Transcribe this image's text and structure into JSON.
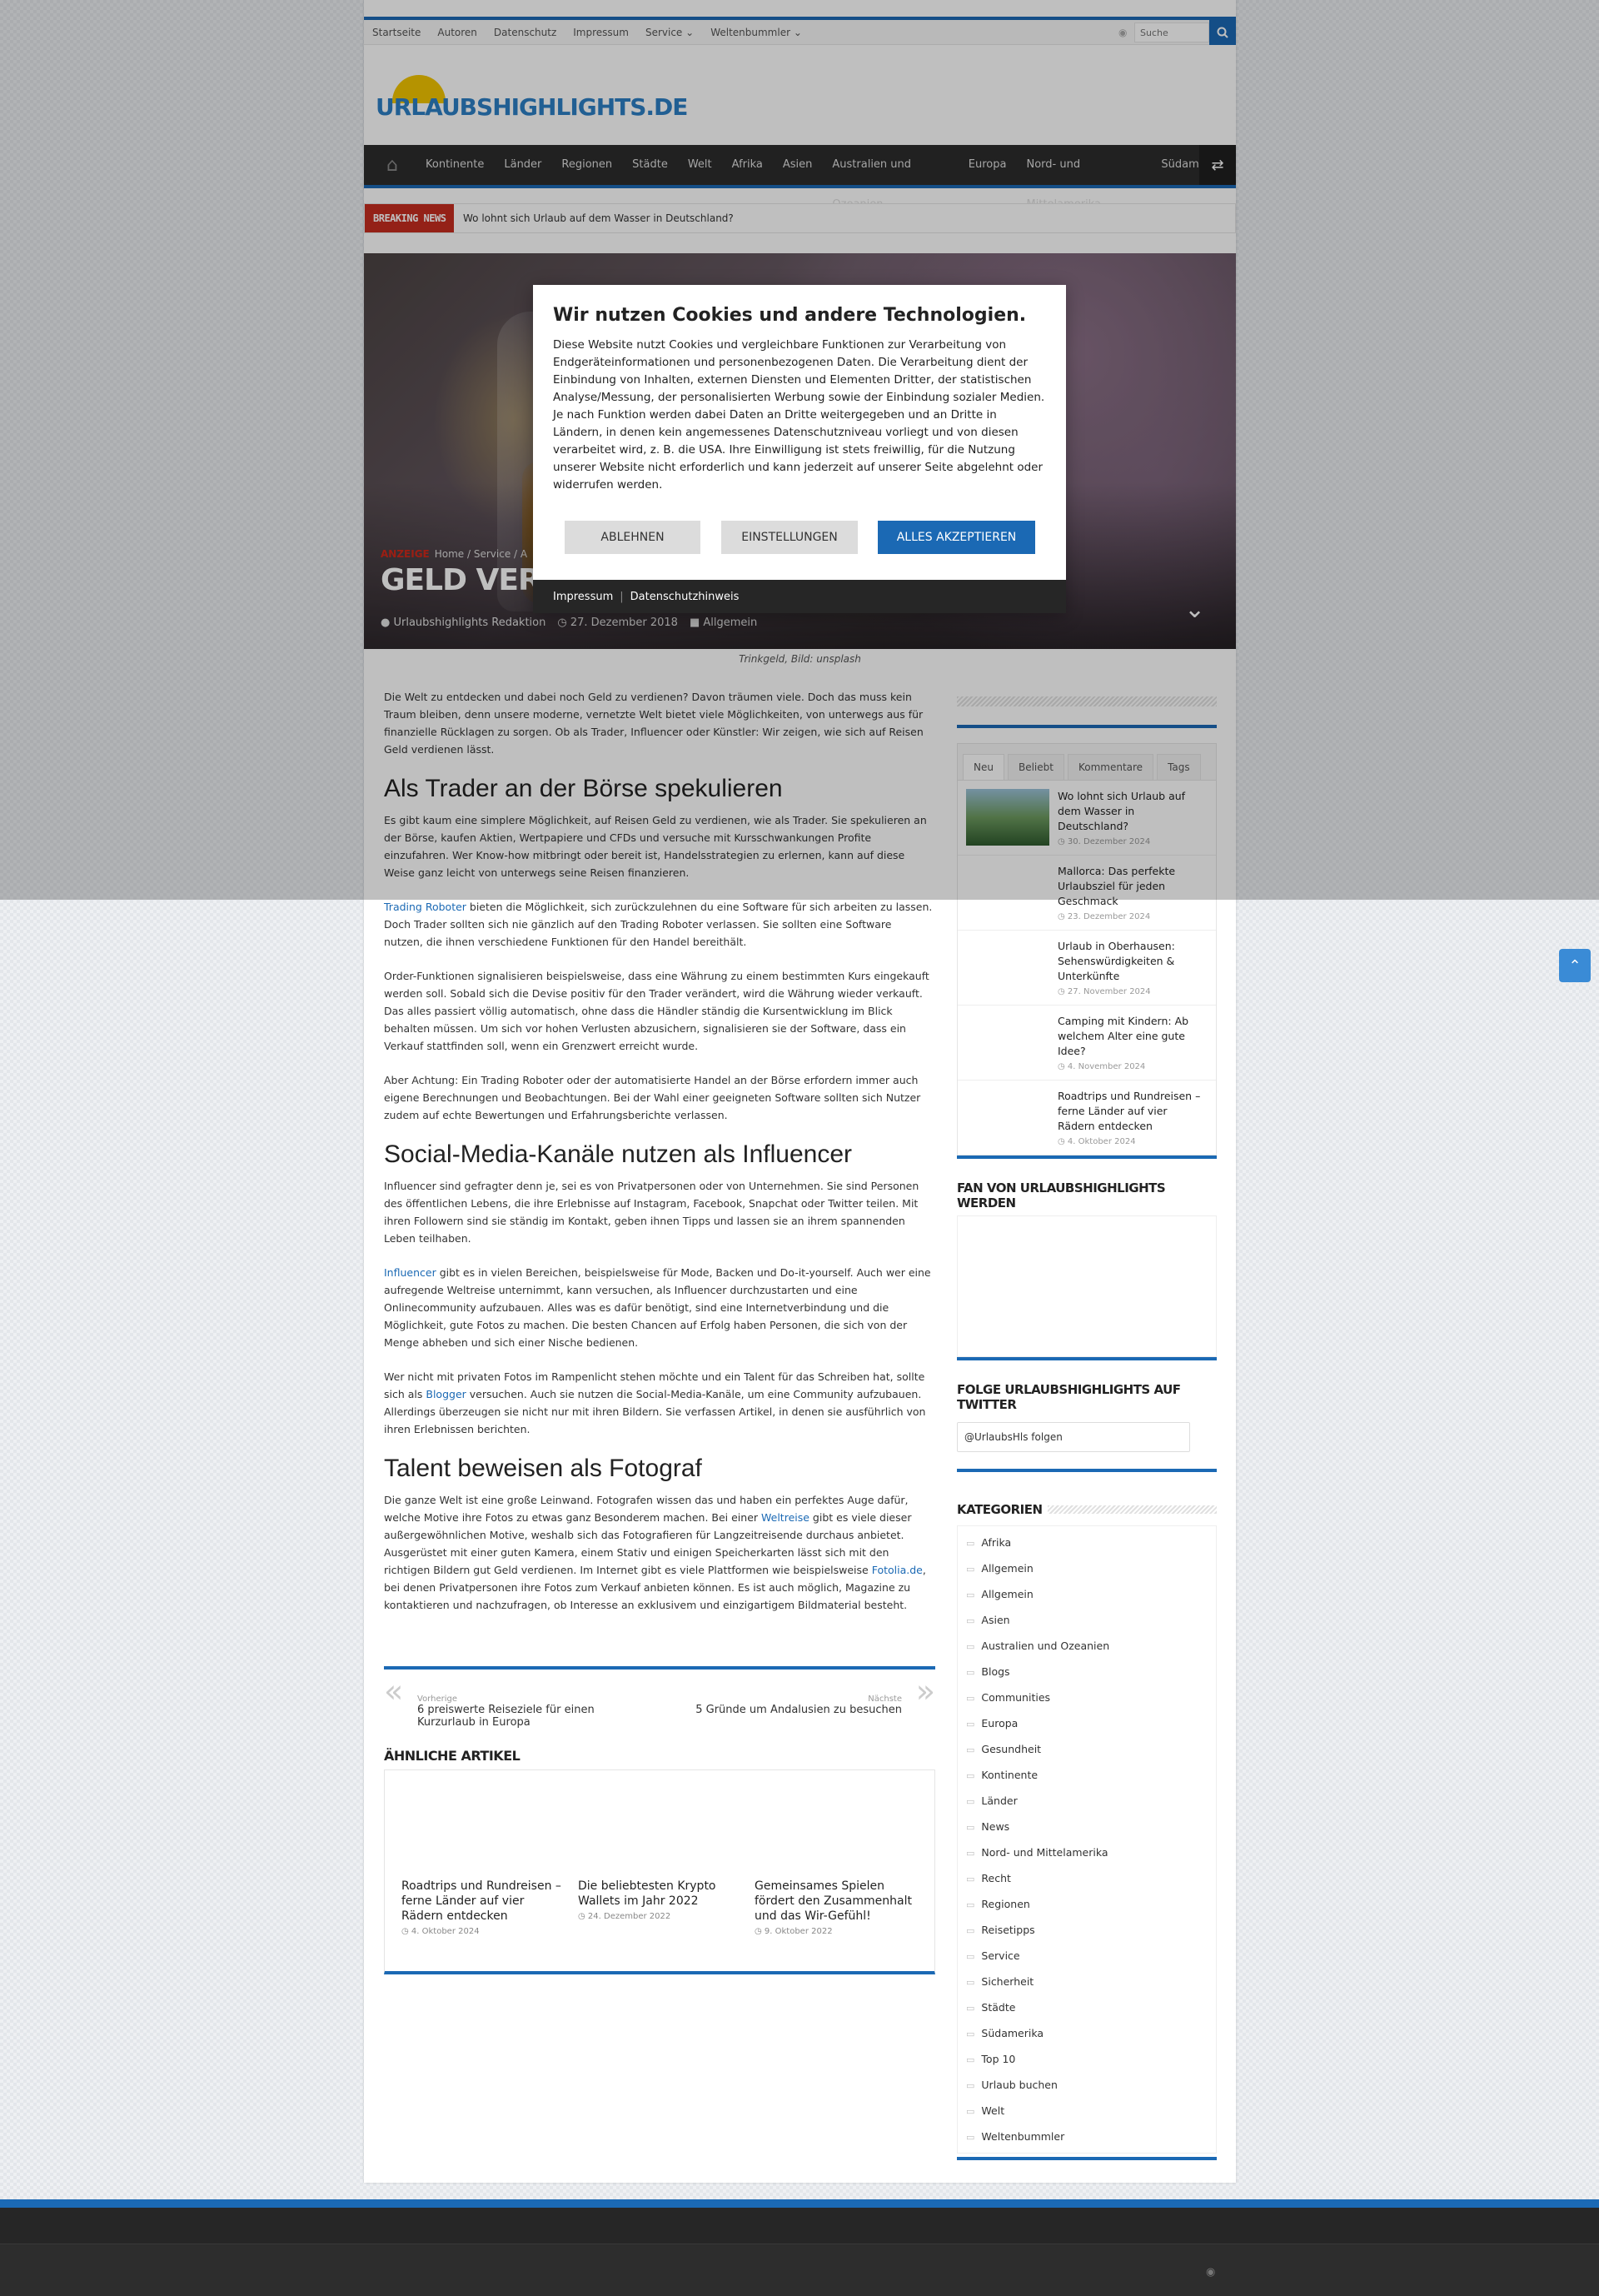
{
  "topnav": [
    "Startseite",
    "Autoren",
    "Datenschutz",
    "Impressum",
    "Service ⌄",
    "Weltenbummler ⌄"
  ],
  "search_placeholder": "Suche",
  "logo": {
    "part1": "URLAUBS",
    "part2": "HIGHLIGHTS.DE"
  },
  "mainnav": [
    "Kontinente",
    "Länder",
    "Regionen",
    "Städte",
    "Welt",
    "Afrika",
    "Asien",
    "Australien und Ozeanien",
    "Europa",
    "Nord- und Mittelamerika",
    "Südamerika"
  ],
  "breaking": {
    "label": "BREAKING NEWS",
    "text": "Wo lohnt sich Urlaub auf dem Wasser in Deutschland?"
  },
  "hero": {
    "ad": "ANZEIGE",
    "crumbs": "Home / Service / A",
    "title": "GELD VERDIE",
    "author": "Urlaubshighlights Redaktion",
    "date": "27. Dezember 2018",
    "category": "Allgemein"
  },
  "caption": "Trinkgeld, Bild: unsplash",
  "article": {
    "intro": "Die Welt zu entdecken und dabei noch Geld zu verdienen? Davon träumen viele. Doch das muss kein Traum bleiben, denn unsere moderne, vernetzte Welt bietet viele Möglichkeiten, von unterwegs aus für finanzielle Rücklagen zu sorgen. Ob als Trader, Influencer oder Künstler: Wir zeigen, wie sich auf Reisen Geld verdienen lässt.",
    "h1": "Als Trader an der Börse spekulieren",
    "p1": "Es gibt kaum eine simplere Möglichkeit, auf Reisen Geld zu verdienen, wie als Trader. Sie spekulieren an der Börse, kaufen Aktien, Wertpapiere und CFDs und versuche mit Kursschwankungen Profite einzufahren. Wer Know-how mitbringt oder bereit ist, Handelsstrategien zu erlernen, kann auf diese Weise ganz leicht von unterwegs seine Reisen finanzieren.",
    "p2_link": "Trading Roboter",
    "p2": " bieten die Möglichkeit, sich zurückzulehnen du eine Software für sich arbeiten zu lassen. Doch Trader sollten sich nie gänzlich auf den Trading Roboter verlassen. Sie sollten eine Software nutzen, die ihnen verschiedene Funktionen für den Handel bereithält.",
    "p3": "Order-Funktionen signalisieren beispielsweise, dass eine Währung zu einem bestimmten Kurs eingekauft werden soll. Sobald sich die Devise positiv für den Trader verändert, wird die Währung wieder verkauft. Das alles passiert völlig automatisch, ohne dass die Händler ständig die Kursentwicklung im Blick behalten müssen. Um sich vor hohen Verlusten abzusichern, signalisieren sie der Software, dass ein Verkauf stattfinden soll, wenn ein Grenzwert erreicht wurde.",
    "p4": "Aber Achtung: Ein Trading Roboter oder der automatisierte Handel an der Börse erfordern immer auch eigene Berechnungen und Beobachtungen. Bei der Wahl einer geeigneten Software sollten sich Nutzer zudem auf echte Bewertungen und Erfahrungsberichte verlassen.",
    "h2": "Social-Media-Kanäle nutzen als Influencer",
    "p5": "Influencer sind gefragter denn je, sei es von Privatpersonen oder von Unternehmen. Sie sind Personen des öffentlichen Lebens, die ihre Erlebnisse auf Instagram, Facebook, Snapchat oder Twitter teilen. Mit ihren Followern sind sie ständig im Kontakt, geben ihnen Tipps und lassen sie an ihrem spannenden Leben teilhaben.",
    "p6_link": "Influencer",
    "p6": " gibt es in vielen Bereichen, beispielsweise für Mode, Backen und Do-it-yourself. Auch wer eine aufregende Weltreise unternimmt, kann versuchen, als Influencer durchzustarten und eine Onlinecommunity aufzubauen. Alles was es dafür benötigt, sind eine Internetverbindung und die Möglichkeit, gute Fotos zu machen. Die besten Chancen auf Erfolg haben Personen, die sich von der Menge abheben und sich einer Nische bedienen.",
    "p7a": "Wer nicht mit privaten Fotos im Rampenlicht stehen möchte und ein Talent für das Schreiben hat, sollte sich als ",
    "p7_link": "Blogger",
    "p7b": " versuchen. Auch sie nutzen die Social-Media-Kanäle, um eine Community aufzubauen. Allerdings überzeugen sie nicht nur mit ihren Bildern. Sie verfassen Artikel, in denen sie ausführlich von ihren Erlebnissen berichten.",
    "h3": "Talent beweisen als Fotograf",
    "p8a": "Die ganze Welt ist eine große Leinwand. Fotografen wissen das und haben ein perfektes Auge dafür, welche Motive ihre Fotos zu etwas ganz Besonderem machen. Bei einer ",
    "p8_link1": "Weltreise",
    "p8b": " gibt es viele dieser außergewöhnlichen Motive, weshalb sich das Fotografieren für Langzeitreisende durchaus anbietet. Ausgerüstet mit einer guten Kamera, einem Stativ und einigen Speicherkarten lässt sich mit den richtigen Bildern gut Geld verdienen. Im Internet gibt es viele Plattformen wie beispielsweise ",
    "p8_link2": "Fotolia.de",
    "p8c": ", bei denen Privatpersonen ihre Fotos zum Verkauf anbieten können. Es ist auch möglich, Magazine zu kontaktieren und nachzufragen, ob Interesse an exklusivem und einzigartigem Bildmaterial besteht."
  },
  "postnav": {
    "prev_label": "Vorherige",
    "prev_title": "6 preiswerte Reiseziele für einen Kurzurlaub in Europa",
    "next_label": "Nächste",
    "next_title": "5 Gründe um Andalusien zu besuchen"
  },
  "related": {
    "heading": "ÄHNLICHE ARTIKEL",
    "items": [
      {
        "title": "Roadtrips und Rundreisen – ferne Länder auf vier Rädern entdecken",
        "date": "4. Oktober 2024"
      },
      {
        "title": "Die beliebtesten Krypto Wallets im Jahr 2022",
        "date": "24. Dezember 2022"
      },
      {
        "title": "Gemeinsames Spielen fördert den Zusammenhalt und das Wir-Gefühl!",
        "date": "9. Oktober 2022"
      }
    ]
  },
  "sidebar": {
    "tabs": [
      "Neu",
      "Beliebt",
      "Kommentare",
      "Tags"
    ],
    "recent": [
      {
        "title": "Wo lohnt sich Urlaub auf dem Wasser in Deutschland?",
        "date": "30. Dezember 2024"
      },
      {
        "title": "Mallorca: Das perfekte Urlaubsziel für jeden Geschmack",
        "date": "23. Dezember 2024"
      },
      {
        "title": "Urlaub in Oberhausen: Sehenswürdigkeiten & Unterkünfte",
        "date": "27. November 2024"
      },
      {
        "title": "Camping mit Kindern: Ab welchem Alter eine gute Idee?",
        "date": "4. November 2024"
      },
      {
        "title": "Roadtrips und Rundreisen – ferne Länder auf vier Rädern entdecken",
        "date": "4. Oktober 2024"
      }
    ],
    "fan_heading": "FAN VON URLAUBSHIGHLIGHTS WERDEN",
    "twitter_heading": "FOLGE URLAUBSHIGHLIGHTS AUF TWITTER",
    "twitter_button": "@UrlaubsHls folgen",
    "cats_heading": "KATEGORIEN",
    "categories": [
      "Afrika",
      "Allgemein",
      "Allgemein",
      "Asien",
      "Australien und Ozeanien",
      "Blogs",
      "Communities",
      "Europa",
      "Gesundheit",
      "Kontinente",
      "Länder",
      "News",
      "Nord- und Mittelamerika",
      "Recht",
      "Regionen",
      "Reisetipps",
      "Service",
      "Sicherheit",
      "Städte",
      "Südamerika",
      "Top 10",
      "Urlaub buchen",
      "Welt",
      "Weltenbummler"
    ]
  },
  "cookie": {
    "title": "Wir nutzen Cookies und andere Technologien.",
    "body": "Diese Website nutzt Cookies und vergleichbare Funktionen zur Verarbeitung von Endgeräteinformationen und personenbezogenen Daten. Die Verarbeitung dient der Einbindung von Inhalten, externen Diensten und Elementen Dritter, der statistischen Analyse/Messung, der personalisierten Werbung sowie der Einbindung sozialer Medien. Je nach Funktion werden dabei Daten an Dritte weitergegeben und an Dritte in Ländern, in denen kein angemessenes Datenschutzniveau vorliegt und von diesen verarbeitet wird, z. B. die USA. Ihre Einwilligung ist stets freiwillig, für die Nutzung unserer Website nicht erforderlich und kann jederzeit auf unserer Seite abgelehnt oder widerrufen werden.",
    "reject": "ABLEHNEN",
    "settings": "EINSTELLUNGEN",
    "accept": "ALLES AKZEPTIEREN",
    "impressum": "Impressum",
    "privacy": "Datenschutzhinweis"
  },
  "colors": {
    "accent": "#1b69b4",
    "breaking": "#c62d1f",
    "dark": "#2d2d2d"
  },
  "icons": [
    "home-icon",
    "search-icon",
    "rss-icon",
    "shuffle-icon",
    "user-icon",
    "clock-icon",
    "folder-icon",
    "chevron-down-icon",
    "arrow-up-icon",
    "folder-outline-icon"
  ]
}
